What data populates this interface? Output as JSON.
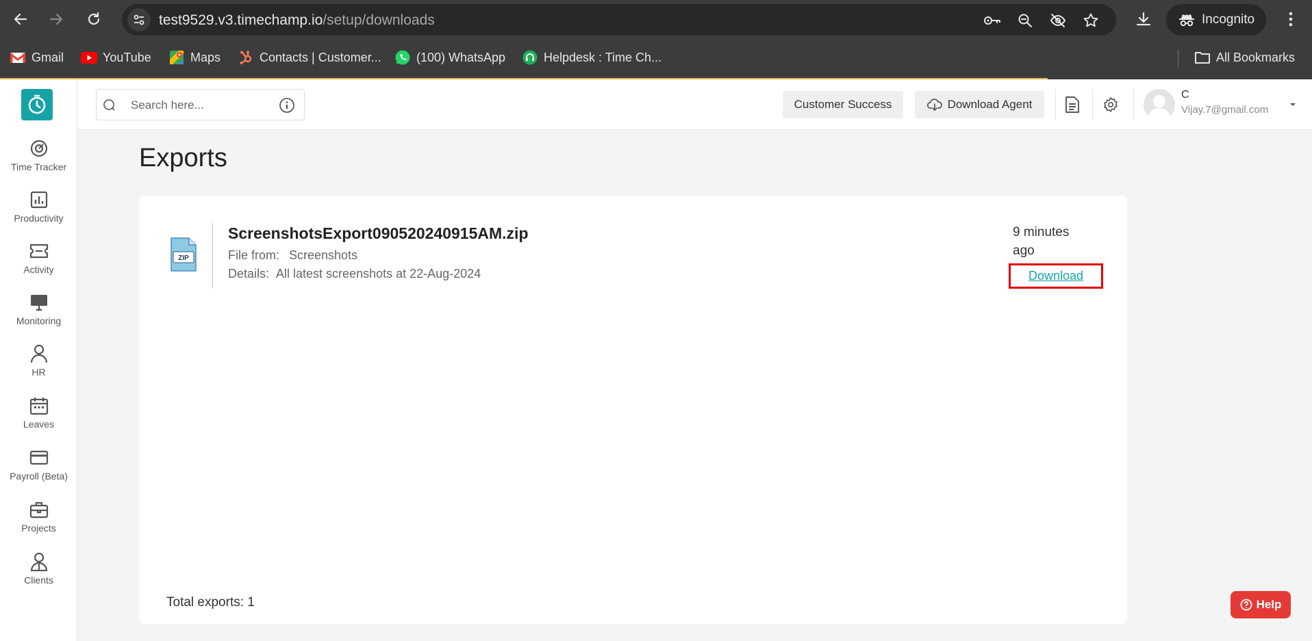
{
  "browser": {
    "url_host": "test9529.v3.timechamp.io",
    "url_path": "/setup/downloads",
    "incognito_label": "Incognito",
    "bookmarks": [
      {
        "label": "Gmail",
        "icon": "gmail-icon"
      },
      {
        "label": "YouTube",
        "icon": "youtube-icon"
      },
      {
        "label": "Maps",
        "icon": "maps-icon"
      },
      {
        "label": "Contacts | Customer...",
        "icon": "hubspot-icon"
      },
      {
        "label": "(100) WhatsApp",
        "icon": "whatsapp-icon"
      },
      {
        "label": "Helpdesk : Time Ch...",
        "icon": "headset-icon"
      }
    ],
    "all_bookmarks_label": "All Bookmarks"
  },
  "sidebar": {
    "items": [
      {
        "label": "Time Tracker",
        "icon": "time-tracker-icon"
      },
      {
        "label": "Productivity",
        "icon": "bar-chart-icon"
      },
      {
        "label": "Activity",
        "icon": "ticket-icon"
      },
      {
        "label": "Monitoring",
        "icon": "monitor-icon"
      },
      {
        "label": "HR",
        "icon": "person-icon"
      },
      {
        "label": "Leaves",
        "icon": "calendar-icon"
      },
      {
        "label": "Payroll (Beta)",
        "icon": "card-icon"
      },
      {
        "label": "Projects",
        "icon": "briefcase-icon"
      },
      {
        "label": "Clients",
        "icon": "client-icon"
      }
    ]
  },
  "header": {
    "search_placeholder": "Search here...",
    "customer_success_label": "Customer Success",
    "download_agent_label": "Download Agent",
    "user_name": "C",
    "user_email": "Vijay.7@gmail.com"
  },
  "page": {
    "title": "Exports",
    "exports": [
      {
        "file_name": "ScreenshotsExport090520240915AM.zip",
        "file_from_key": "File from:",
        "file_from_value": "Screenshots",
        "details_key": "Details:",
        "details_value": "All latest screenshots at 22-Aug-2024",
        "time_ago": "9 minutes ago",
        "download_label": "Download",
        "file_type": "ZIP"
      }
    ],
    "total_label": "Total exports: 1"
  },
  "help_label": "Help",
  "colors": {
    "accent": "#16a3a6",
    "highlight_box": "#e00000",
    "help": "#e53935"
  }
}
